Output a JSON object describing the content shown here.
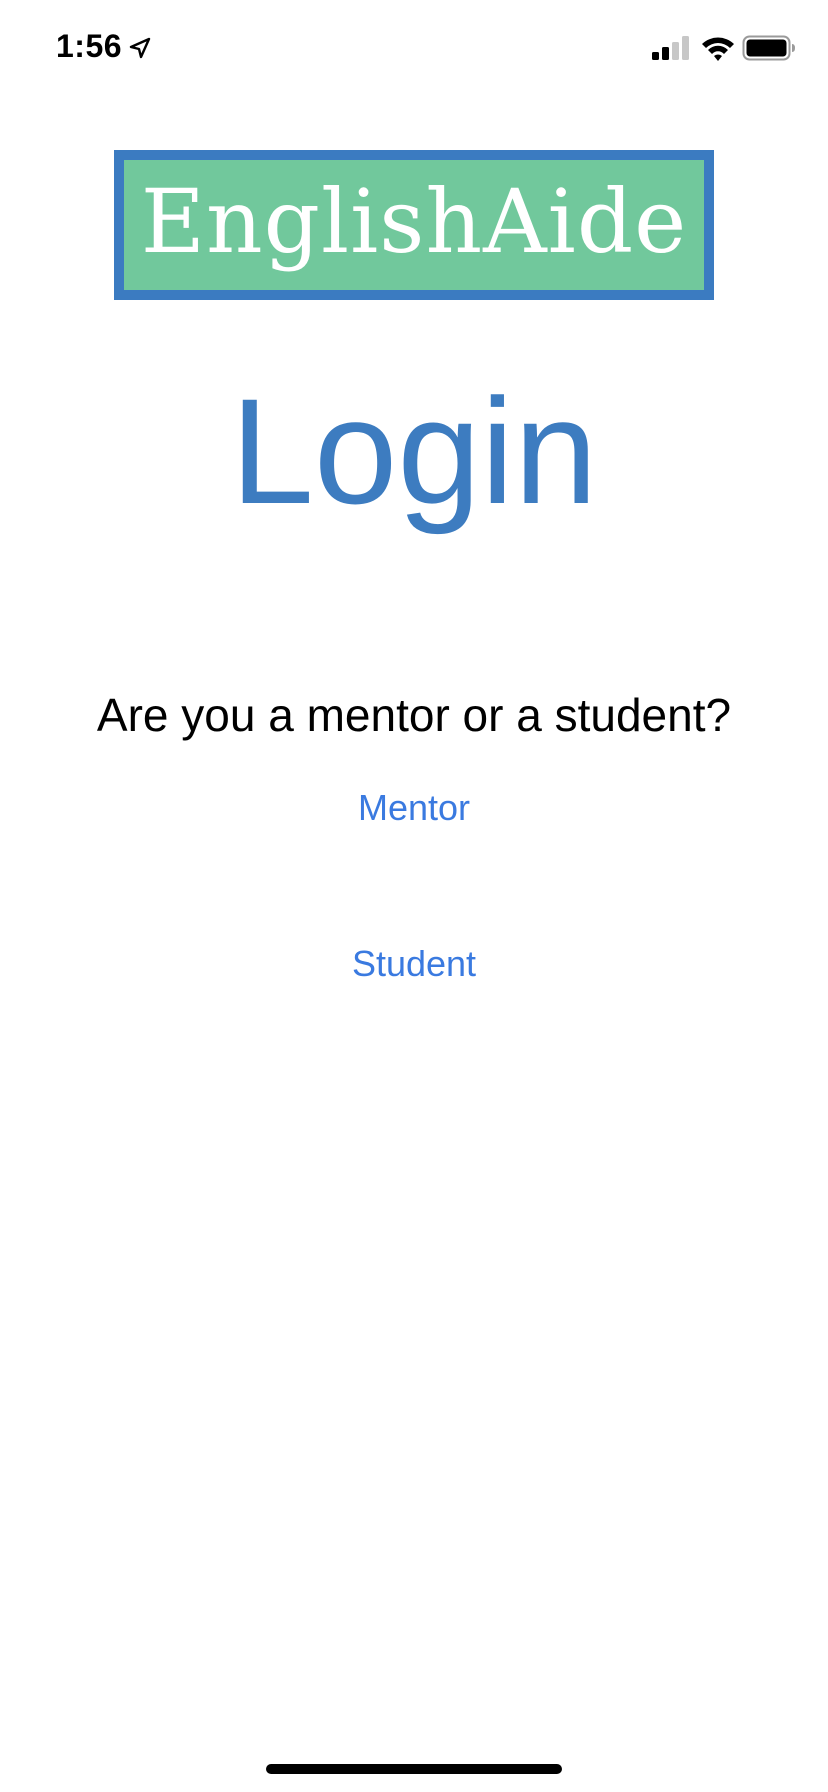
{
  "status_bar": {
    "time": "1:56",
    "icons": [
      "location-arrow-icon",
      "cellular-signal-icon",
      "wifi-icon",
      "battery-icon"
    ]
  },
  "logo": {
    "text": "EnglishAide",
    "border_color": "#3b7bc1",
    "fill_color": "#71c89c"
  },
  "title": "Login",
  "question": "Are you a mentor or a student?",
  "buttons": {
    "mentor": "Mentor",
    "student": "Student"
  },
  "colors": {
    "accent": "#3d7cc0",
    "link": "#3a7ae0"
  }
}
